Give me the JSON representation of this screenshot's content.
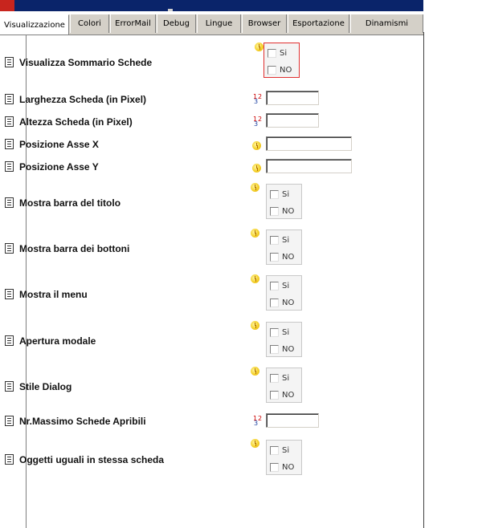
{
  "tabs": [
    "Visualizzazione",
    "Colori",
    "ErrorMail",
    "Debug",
    "Lingue",
    "Browser",
    "Esportazione",
    "Dinamismi"
  ],
  "active_tab": "Visualizzazione",
  "rows": [
    {
      "label": "Visualizza Sommario Schede",
      "control": "choice",
      "options": [
        "Si",
        "NO"
      ],
      "highlighted": true
    },
    {
      "label": "Larghezza Scheda (in Pixel)",
      "control": "number",
      "value": ""
    },
    {
      "label": "Altezza Scheda (in Pixel)",
      "control": "number",
      "value": ""
    },
    {
      "label": "Posizione Asse X",
      "control": "text",
      "value": ""
    },
    {
      "label": "Posizione Asse Y",
      "control": "text",
      "value": ""
    },
    {
      "label": "Mostra barra del titolo",
      "control": "choice",
      "options": [
        "Si",
        "NO"
      ]
    },
    {
      "label": "Mostra barra dei bottoni",
      "control": "choice",
      "options": [
        "Si",
        "NO"
      ]
    },
    {
      "label": "Mostra il menu",
      "control": "choice",
      "options": [
        "Si",
        "NO"
      ]
    },
    {
      "label": "Apertura modale",
      "control": "choice",
      "options": [
        "Si",
        "NO"
      ]
    },
    {
      "label": "Stile Dialog",
      "control": "choice",
      "options": [
        "Si",
        "NO"
      ]
    },
    {
      "label": "Nr.Massimo Schede Apribili",
      "control": "number",
      "value": ""
    },
    {
      "label": "Oggetti uguali in stessa scheda",
      "control": "choice",
      "options": [
        "Si",
        "NO"
      ]
    }
  ],
  "icons": {
    "row": "document-icon",
    "choice": "clock-icon",
    "number": "numeric-icon"
  },
  "colors": {
    "titlebar": "#0a246a",
    "highlight": "#e03030",
    "tabbar": "#d4d0c8"
  }
}
